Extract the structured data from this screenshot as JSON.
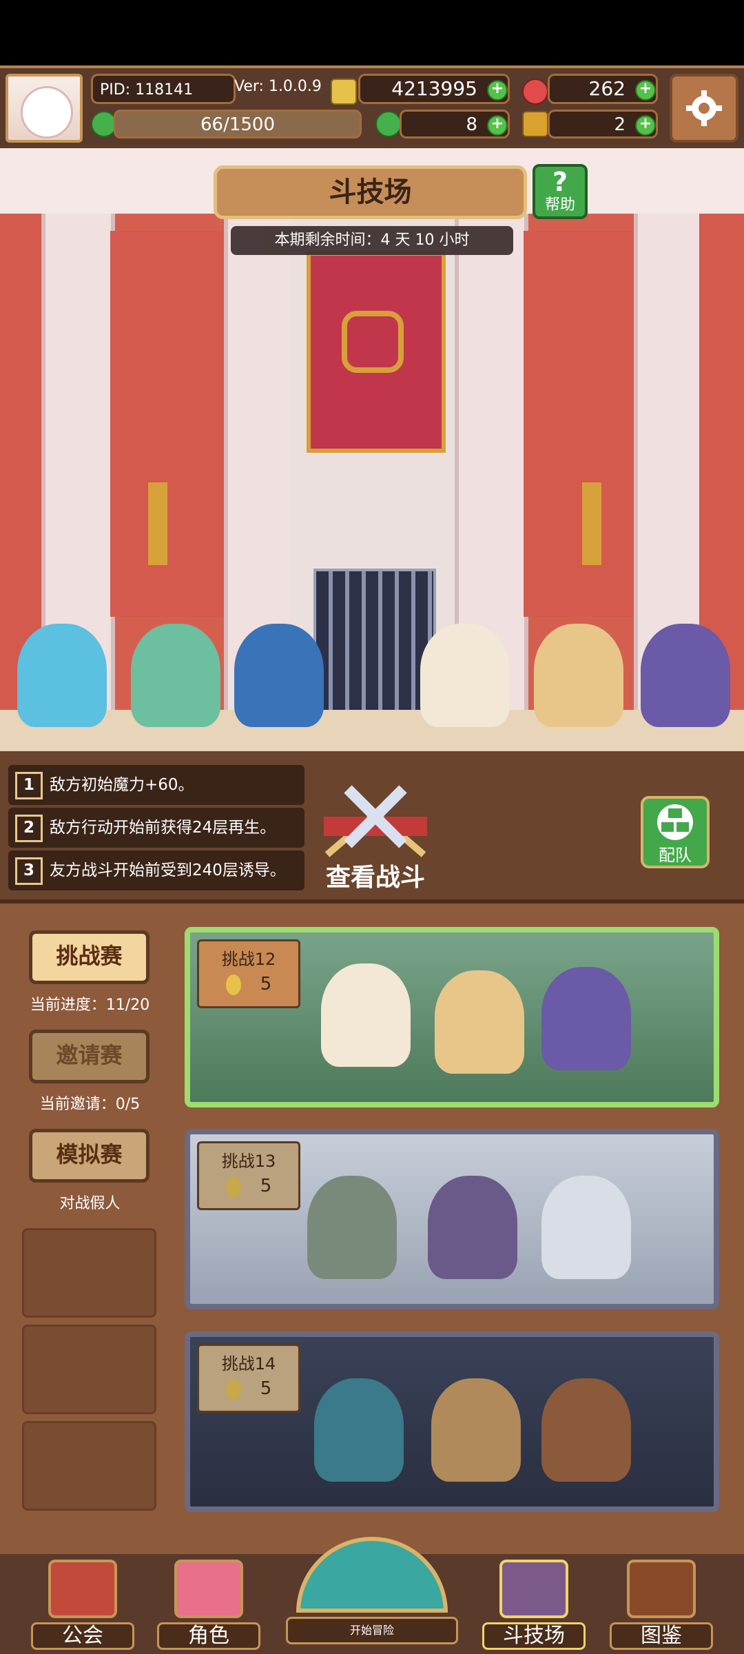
{
  "topbar": {
    "pid": "PID: 118141",
    "version": "Ver: 1.0.0.9",
    "gold": "4213995",
    "gems": "262",
    "stamina": "66/1500",
    "clover": "8",
    "keys": "2"
  },
  "arena": {
    "title": "斗技场",
    "help_label": "帮助",
    "time_left": "本期剩余时间：4 天 10 小时"
  },
  "rules": [
    {
      "n": "1",
      "text": "敌方初始魔力+60。"
    },
    {
      "n": "2",
      "text": "敌方行动开始前获得24层再生。"
    },
    {
      "n": "3",
      "text": "友方战斗开始前受到240层诱导。"
    }
  ],
  "view_battle_label": "查看战斗",
  "team_label": "配队",
  "modes": [
    {
      "label": "挑战赛",
      "sub": "当前进度：11/20"
    },
    {
      "label": "邀请赛",
      "sub": "当前邀请：0/5"
    },
    {
      "label": "模拟赛",
      "sub": "对战假人"
    }
  ],
  "challenges": [
    {
      "title": "挑战12",
      "cost": "5"
    },
    {
      "title": "挑战13",
      "cost": "5"
    },
    {
      "title": "挑战14",
      "cost": "5"
    }
  ],
  "nav": {
    "guild": "公会",
    "character": "角色",
    "start": "开始冒险",
    "arena": "斗技场",
    "codex": "图鉴"
  }
}
